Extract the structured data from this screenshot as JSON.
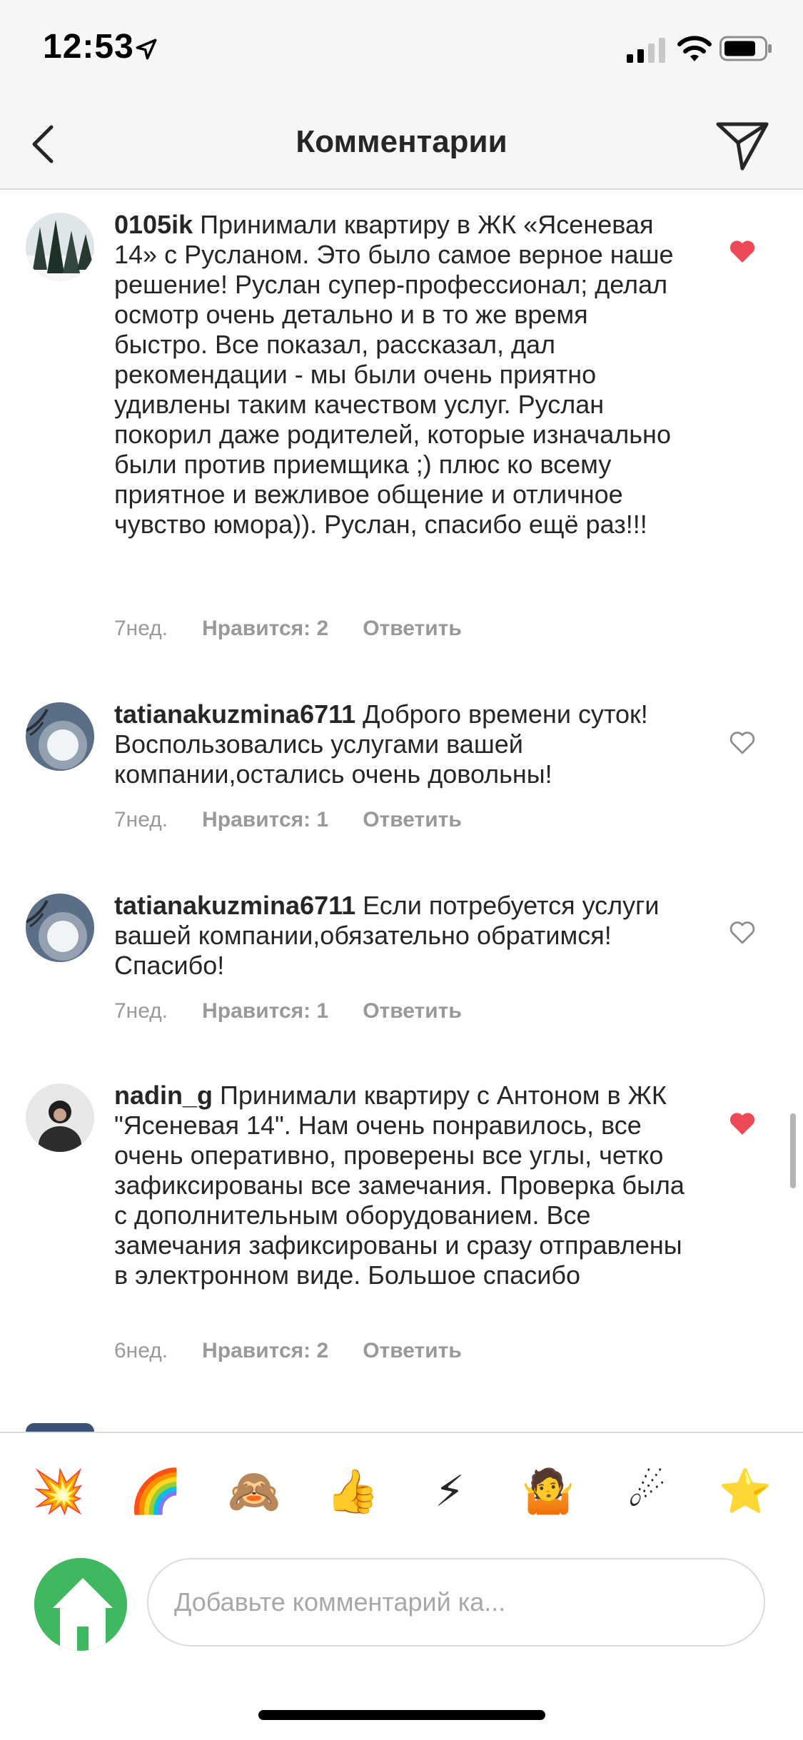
{
  "status_bar": {
    "time": "12:53",
    "icons": [
      "location-arrow-icon",
      "cellular-signal-icon",
      "wifi-icon",
      "battery-icon"
    ]
  },
  "nav": {
    "title": "Комментарии",
    "back_icon": "chevron-left-icon",
    "send_icon": "paper-plane-icon"
  },
  "comments": [
    {
      "username": "0105ik",
      "text": " Принимали квартиру в ЖК «Ясеневая 14» с Русланом. Это было самое верное наше решение! Руслан супер-профессионал; делал осмотр очень детально и в то же время быстро. Все показал, рассказал, дал рекомендации - мы были очень приятно удивлены таким качеством услуг. Руслан покорил даже родителей, которые изначально были против приемщика ;) плюс ко всему приятное и вежливое общение и отличное чувство юмора)). Руслан, спасибо ещё раз!!!",
      "age": "7нед.",
      "likes": "Нравится: 2",
      "reply": "Ответить",
      "liked": true
    },
    {
      "username": "tatianakuzmina6711",
      "text": " Доброго времени суток! Воспользовались услугами вашей компании,остались очень довольны!",
      "age": "7нед.",
      "likes": "Нравится: 1",
      "reply": "Ответить",
      "liked": false
    },
    {
      "username": "tatianakuzmina6711",
      "text": " Если потребуется услуги вашей компании,обязательно обратимся!Спасибо!",
      "age": "7нед.",
      "likes": "Нравится: 1",
      "reply": "Ответить",
      "liked": false
    },
    {
      "username": "nadin_g",
      "text": " Принимали квартиру с Антоном в ЖК \"Ясеневая 14\". Нам очень понравилось, все очень оперативно, проверены все углы, четко зафиксированы все замечания. Проверка была с дополнительным оборудованием. Все замечания зафиксированы и сразу отправлены в электронном виде. Большое спасибо",
      "age": "6нед.",
      "likes": "Нравится: 2",
      "reply": "Ответить",
      "liked": true
    }
  ],
  "colors": {
    "liked_heart": "#ed4956",
    "meta_text": "#999999",
    "divider": "#dbdbdb",
    "avatar_green": "#3fb85f"
  },
  "emoji_bar": [
    "💥",
    "🌈",
    "🙈",
    "👍",
    "⚡",
    "🤷",
    "☄",
    "⭐"
  ],
  "composer": {
    "placeholder": "Добавьте комментарий ка...",
    "avatar_icon": "house-icon"
  }
}
